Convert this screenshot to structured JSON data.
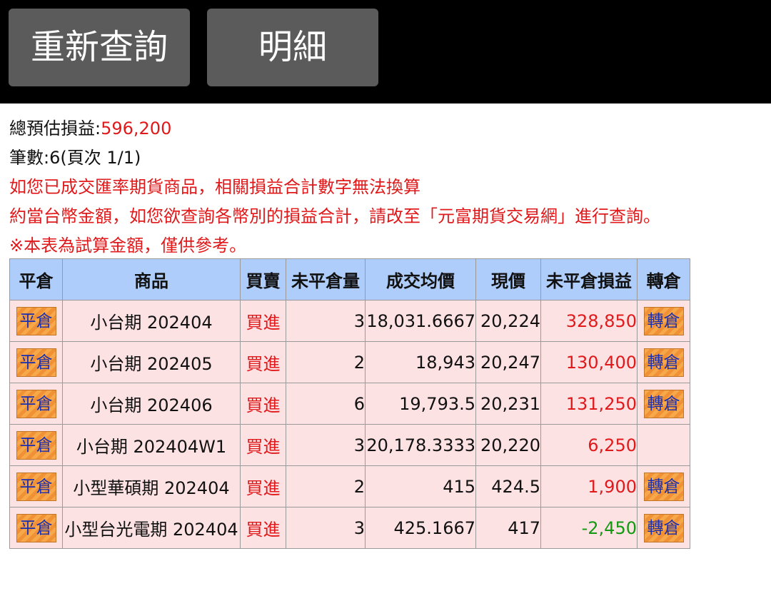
{
  "toolbar": {
    "requery_label": "重新查詢",
    "detail_label": "明細"
  },
  "summary": {
    "total_label": "總預估損益:",
    "total_value": "596,200",
    "count_text": "筆數:6(頁次 1/1)",
    "notice_line1": "如您已成交匯率期貨商品，相關損益合計數字無法換算",
    "notice_line2": "約當台幣金額，如您欲查詢各幣別的損益合計，請改至「元富期貨交易網」進行查詢。",
    "notice_line3": "※本表為試算金額，僅供參考。"
  },
  "table": {
    "headers": [
      "平倉",
      "商品",
      "買賣",
      "未平倉量",
      "成交均價",
      "現價",
      "未平倉損益",
      "轉倉"
    ],
    "close_label": "平倉",
    "roll_label": "轉倉",
    "rows": [
      {
        "product": "小台期 202404",
        "side": "買進",
        "qty": "3",
        "avg_price": "18,031.6667",
        "price": "20,224",
        "pnl": "328,850",
        "pnl_sign": "pos",
        "roll": true
      },
      {
        "product": "小台期 202405",
        "side": "買進",
        "qty": "2",
        "avg_price": "18,943",
        "price": "20,247",
        "pnl": "130,400",
        "pnl_sign": "pos",
        "roll": true
      },
      {
        "product": "小台期 202406",
        "side": "買進",
        "qty": "6",
        "avg_price": "19,793.5",
        "price": "20,231",
        "pnl": "131,250",
        "pnl_sign": "pos",
        "roll": true
      },
      {
        "product": "小台期 202404W1",
        "side": "買進",
        "qty": "3",
        "avg_price": "20,178.3333",
        "price": "20,220",
        "pnl": "6,250",
        "pnl_sign": "pos",
        "roll": false
      },
      {
        "product": "小型華碩期 202404",
        "side": "買進",
        "qty": "2",
        "avg_price": "415",
        "price": "424.5",
        "pnl": "1,900",
        "pnl_sign": "pos",
        "roll": true
      },
      {
        "product": "小型台光電期 202404",
        "side": "買進",
        "qty": "3",
        "avg_price": "425.1667",
        "price": "417",
        "pnl": "-2,450",
        "pnl_sign": "neg",
        "roll": true
      }
    ]
  },
  "colors": {
    "header_bg": "#aecdfa",
    "row_bg": "#fde2e4",
    "positive": "#e0191b",
    "negative": "#119a11",
    "button_bg": "#5b5b5b"
  }
}
